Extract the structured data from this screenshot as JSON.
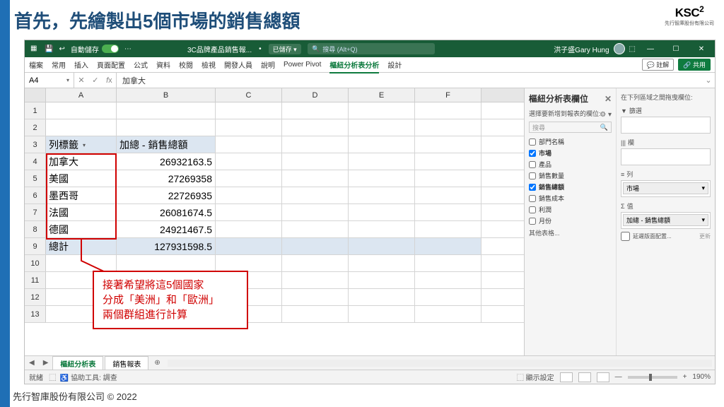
{
  "slide": {
    "title": "首先，先繪製出5個市場的銷售總額",
    "logo": "KSC",
    "logo_sup": "2",
    "logo_sub": "先行智庫股份有限公司",
    "footer": "先行智庫股份有限公司 © 2022"
  },
  "titlebar": {
    "autosave": "自動儲存",
    "filename": "3C品牌產品銷售報...",
    "saved": "已儲存 ▾",
    "search_placeholder": "搜尋 (Alt+Q)",
    "user": "洪子盛Gary Hung",
    "menu_icon": "☰"
  },
  "ribbon": {
    "tabs": [
      "檔案",
      "常用",
      "插入",
      "頁面配置",
      "公式",
      "資料",
      "校閱",
      "檢視",
      "開發人員",
      "說明",
      "Power Pivot",
      "樞紐分析表分析",
      "設計"
    ],
    "active_index": 11,
    "comment": "註解",
    "share": "共用"
  },
  "formula": {
    "cell_ref": "A4",
    "value": "加拿大"
  },
  "columns": [
    "A",
    "B",
    "C",
    "D",
    "E",
    "F"
  ],
  "rows": [
    {
      "n": "1",
      "a": "",
      "b": ""
    },
    {
      "n": "2",
      "a": "",
      "b": ""
    },
    {
      "n": "3",
      "a": "列標籤",
      "b": "加總 - 銷售總額",
      "hdr": true,
      "drop": true
    },
    {
      "n": "4",
      "a": "加拿大",
      "b": "26932163.5"
    },
    {
      "n": "5",
      "a": "美國",
      "b": "27269358"
    },
    {
      "n": "6",
      "a": "墨西哥",
      "b": "22726935"
    },
    {
      "n": "7",
      "a": "法國",
      "b": "26081674.5"
    },
    {
      "n": "8",
      "a": "德國",
      "b": "24921467.5"
    },
    {
      "n": "9",
      "a": "總計",
      "b": "127931598.5",
      "total": true
    },
    {
      "n": "10",
      "a": "",
      "b": ""
    },
    {
      "n": "11",
      "a": "",
      "b": ""
    },
    {
      "n": "12",
      "a": "",
      "b": ""
    },
    {
      "n": "13",
      "a": "",
      "b": ""
    }
  ],
  "callout": {
    "l1": "接著希望將這5個國家",
    "l2": "分成「美洲」和「歐洲」",
    "l3": "兩個群組進行計算"
  },
  "sheets": {
    "tabs": [
      "樞紐分析表",
      "銷售報表"
    ],
    "active": 0,
    "ready": "就緒",
    "assist": "協助工具: 調查"
  },
  "panel": {
    "title": "樞紐分析表欄位",
    "sub": "選擇要新增到報表的欄位:",
    "search": "搜尋",
    "fields": [
      {
        "label": "部門名稱",
        "checked": false
      },
      {
        "label": "市場",
        "checked": true
      },
      {
        "label": "產品",
        "checked": false
      },
      {
        "label": "銷售數量",
        "checked": false
      },
      {
        "label": "銷售總額",
        "checked": true
      },
      {
        "label": "銷售成本",
        "checked": false
      },
      {
        "label": "利潤",
        "checked": false
      },
      {
        "label": "月份",
        "checked": false
      }
    ],
    "other": "其他表格...",
    "areas_hint": "在下列區域之間拖曳欄位:",
    "filter": "篩選",
    "column": "欄",
    "row": "列",
    "row_item": "市場",
    "values": "值",
    "value_item": "加總 - 銷售總額",
    "defer": "延遲版面配置...",
    "update": "更新"
  },
  "status": {
    "display": "顯示設定",
    "zoom": "190%"
  }
}
